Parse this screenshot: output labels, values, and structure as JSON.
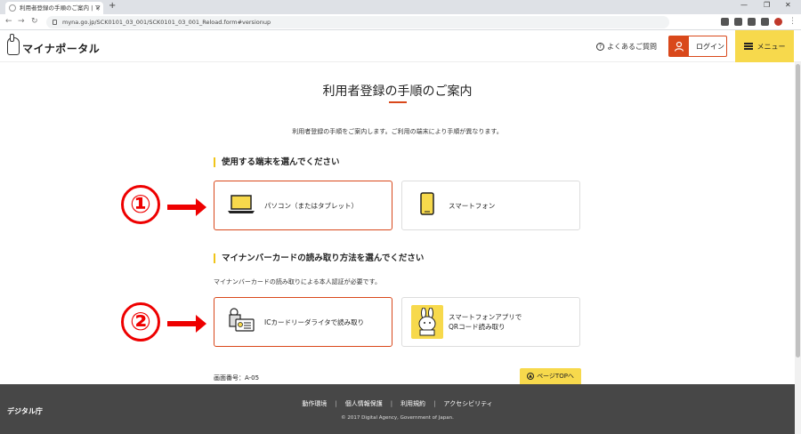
{
  "browser": {
    "tab_title": "利用者登録の手順のご案内 | マ",
    "url": "myna.go.jp/SCK0101_03_001/SCK0101_03_001_Reload.form#versionup"
  },
  "header": {
    "logo_text": "マイナポータル",
    "faq_label": "よくあるご質問",
    "login_label": "ログイン",
    "menu_label": "メニュー"
  },
  "main": {
    "title": "利用者登録の手順のご案内",
    "intro": "利用者登録の手順をご案内します。ご利用の端末により手順が異なります。",
    "section1": {
      "heading": "使用する端末を選んでください",
      "options": [
        {
          "label": "パソコン（またはタブレット）",
          "selected": true
        },
        {
          "label": "スマートフォン",
          "selected": false
        }
      ]
    },
    "section2": {
      "heading": "マイナンバーカードの読み取り方法を選んでください",
      "sub": "マイナンバーカードの読み取りによる本人認証が必要です。",
      "options": [
        {
          "label": "ICカードリーダライタで読み取り",
          "selected": true
        },
        {
          "label_line1": "スマートフォンアプリで",
          "label_line2": "QRコード読み取り",
          "selected": false
        }
      ]
    },
    "markers": [
      "①",
      "②"
    ],
    "screen_number": "画面番号：A-05",
    "pagetop_label": "ページTOPへ"
  },
  "footer": {
    "agency": "デジタル庁",
    "links": [
      "動作環境",
      "個人情報保護",
      "利用規約",
      "アクセシビリティ"
    ],
    "copyright": "© 2017 Digital Agency, Government of Japan."
  },
  "colors": {
    "accent": "#d9481b",
    "yellow": "#f7d94c",
    "footer": "#474747",
    "annotation": "#e00000"
  }
}
